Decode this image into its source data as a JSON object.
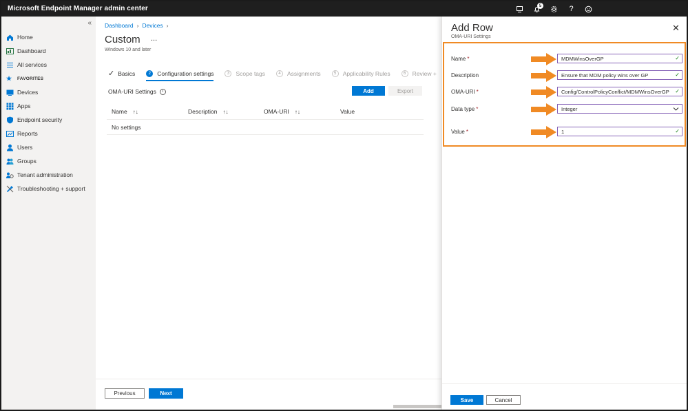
{
  "app": {
    "title": "Microsoft Endpoint Manager admin center"
  },
  "topbar": {
    "icons": [
      "remote-icon",
      "bell-icon",
      "gear-icon",
      "help-icon",
      "smiley-icon"
    ],
    "notification_count": "5"
  },
  "sidebar": {
    "collapse_glyph": "«",
    "items": [
      {
        "label": "Home",
        "icon": "home-icon"
      },
      {
        "label": "Dashboard",
        "icon": "dashboard-icon"
      },
      {
        "label": "All services",
        "icon": "list-icon"
      },
      {
        "label": "FAVORITES",
        "icon": "star-icon"
      },
      {
        "label": "Devices",
        "icon": "devices-icon"
      },
      {
        "label": "Apps",
        "icon": "apps-icon"
      },
      {
        "label": "Endpoint security",
        "icon": "shield-icon"
      },
      {
        "label": "Reports",
        "icon": "reports-icon"
      },
      {
        "label": "Users",
        "icon": "user-icon"
      },
      {
        "label": "Groups",
        "icon": "groups-icon"
      },
      {
        "label": "Tenant administration",
        "icon": "tenant-icon"
      },
      {
        "label": "Troubleshooting + support",
        "icon": "wrench-icon"
      }
    ]
  },
  "main": {
    "breadcrumb": [
      "Dashboard",
      "Devices"
    ],
    "title": "Custom",
    "more": "...",
    "subtitle": "Windows 10 and later",
    "steps": [
      {
        "label": "Basics",
        "num": ""
      },
      {
        "label": "Configuration settings",
        "num": "2"
      },
      {
        "label": "Scope tags",
        "num": "3"
      },
      {
        "label": "Assignments",
        "num": "4"
      },
      {
        "label": "Applicability Rules",
        "num": "5"
      },
      {
        "label": "Review +",
        "num": "6"
      }
    ],
    "oma_label": "OMA-URI Settings",
    "add_label": "Add",
    "export_label": "Export",
    "columns": [
      "Name",
      "Description",
      "OMA-URI",
      "Value"
    ],
    "empty_text": "No settings",
    "previous_label": "Previous",
    "next_label": "Next"
  },
  "panel": {
    "title": "Add Row",
    "subtitle": "OMA-URI Settings",
    "fields": [
      {
        "label": "Name",
        "required": "*",
        "value": "MDMWinsOverGP"
      },
      {
        "label": "Description",
        "required": "",
        "value": "Ensure that MDM policy wins over GP"
      },
      {
        "label": "OMA-URI",
        "required": "*",
        "value": "Config/ControlPolicyConflict/MDMWinsOverGP"
      },
      {
        "label": "Data type",
        "required": "*",
        "value": "Integer"
      },
      {
        "label": "Value",
        "required": "*",
        "value": "1"
      }
    ],
    "save_label": "Save",
    "cancel_label": "Cancel"
  },
  "colors": {
    "accent": "#0078d4",
    "highlight": "#f08a24",
    "topbar": "#1f1f1f",
    "input_border": "#8764b8",
    "valid": "#107c10"
  }
}
